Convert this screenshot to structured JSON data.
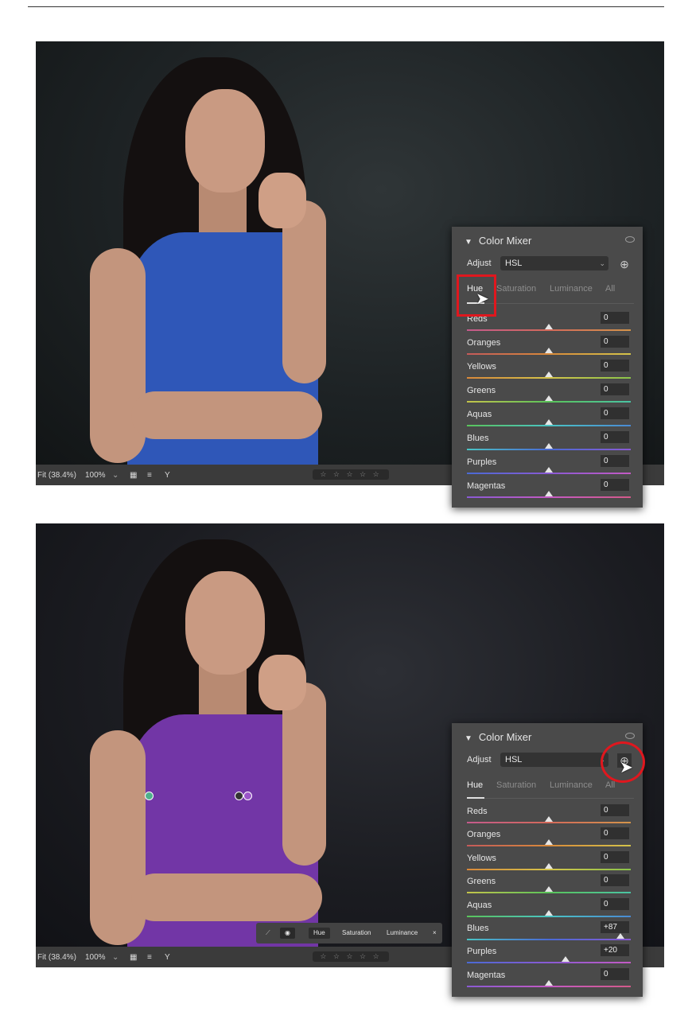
{
  "viewer_status": {
    "fit": "Fit (38.4%)",
    "zoom": "100%",
    "rating_stars": "☆ ☆ ☆ ☆ ☆"
  },
  "panel": {
    "title": "Color Mixer",
    "adjust_label": "Adjust",
    "adjust_value": "HSL",
    "tabs": [
      "Hue",
      "Saturation",
      "Luminance",
      "All"
    ],
    "active_tab": "Hue"
  },
  "sliders_before": [
    {
      "label": "Reds",
      "value": "0"
    },
    {
      "label": "Oranges",
      "value": "0"
    },
    {
      "label": "Yellows",
      "value": "0"
    },
    {
      "label": "Greens",
      "value": "0"
    },
    {
      "label": "Aquas",
      "value": "0"
    },
    {
      "label": "Blues",
      "value": "0"
    },
    {
      "label": "Purples",
      "value": "0"
    },
    {
      "label": "Magentas",
      "value": "0"
    }
  ],
  "sliders_after": [
    {
      "label": "Reds",
      "value": "0"
    },
    {
      "label": "Oranges",
      "value": "0"
    },
    {
      "label": "Yellows",
      "value": "0"
    },
    {
      "label": "Greens",
      "value": "0"
    },
    {
      "label": "Aquas",
      "value": "0"
    },
    {
      "label": "Blues",
      "value": "+87"
    },
    {
      "label": "Purples",
      "value": "+20"
    },
    {
      "label": "Magentas",
      "value": "0"
    }
  ],
  "targeted_toolbar": {
    "hue": "Hue",
    "saturation": "Saturation",
    "luminance": "Luminance",
    "close": "×"
  },
  "colors": {
    "panel_bg": "#4a4a4a",
    "highlight": "#e0171e",
    "dress_before": "#2f57b8",
    "dress_after": "#7236a6"
  }
}
